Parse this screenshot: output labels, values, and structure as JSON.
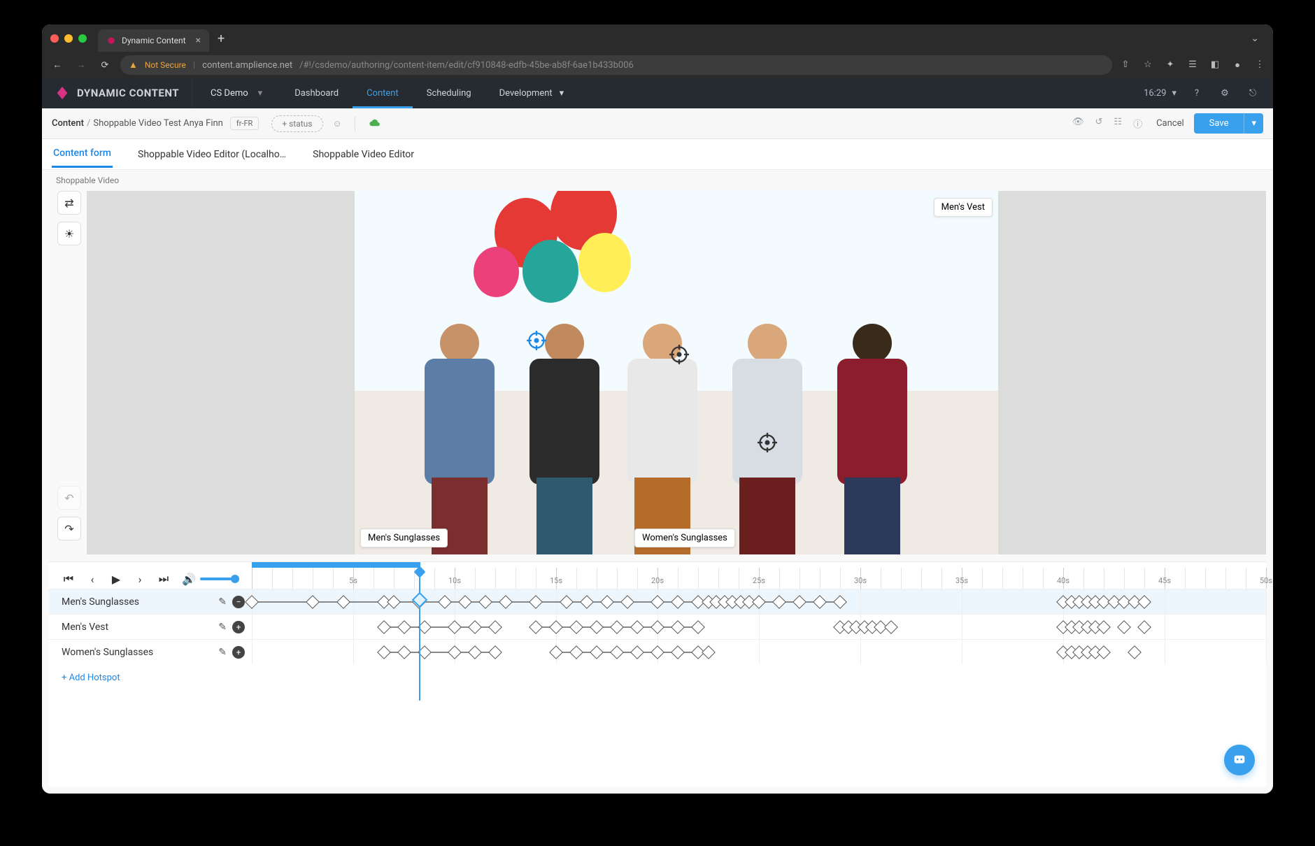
{
  "browser": {
    "tab_title": "Dynamic Content",
    "not_secure": "Not Secure",
    "url_host": "content.amplience.net",
    "url_path": "/#!/csdemo/authoring/content-item/edit/cf910848-edfb-45be-ab8f-6ae1b433b006"
  },
  "app": {
    "brand": "DYNAMIC CONTENT",
    "hub": "CS Demo",
    "nav": {
      "dashboard": "Dashboard",
      "content": "Content",
      "scheduling": "Scheduling",
      "development": "Development"
    },
    "clock": "16:29"
  },
  "crumb": {
    "root": "Content",
    "item": "Shoppable Video Test Anya Finn",
    "locale": "fr-FR",
    "status": "+ status",
    "cancel": "Cancel",
    "save": "Save"
  },
  "subtabs": {
    "form": "Content form",
    "editor_local": "Shoppable Video Editor (Localho…",
    "editor": "Shoppable Video Editor"
  },
  "section_label": "Shoppable Video",
  "hotspots": {
    "mens_sunglasses": "Men's Sunglasses",
    "womens_sunglasses": "Women's Sunglasses",
    "mens_vest": "Men's Vest"
  },
  "timeline": {
    "ticks": [
      "5s",
      "10s",
      "15s",
      "20s",
      "25s",
      "30s",
      "35s",
      "40s",
      "45s",
      "50s"
    ],
    "playhead_pct": 16.5,
    "add": "+ Add Hotspot",
    "rows": [
      {
        "label": "Men's Sunglasses",
        "selected": true,
        "op": "minus"
      },
      {
        "label": "Men's Vest",
        "selected": false,
        "op": "plus"
      },
      {
        "label": "Women's Sunglasses",
        "selected": false,
        "op": "plus"
      }
    ]
  }
}
